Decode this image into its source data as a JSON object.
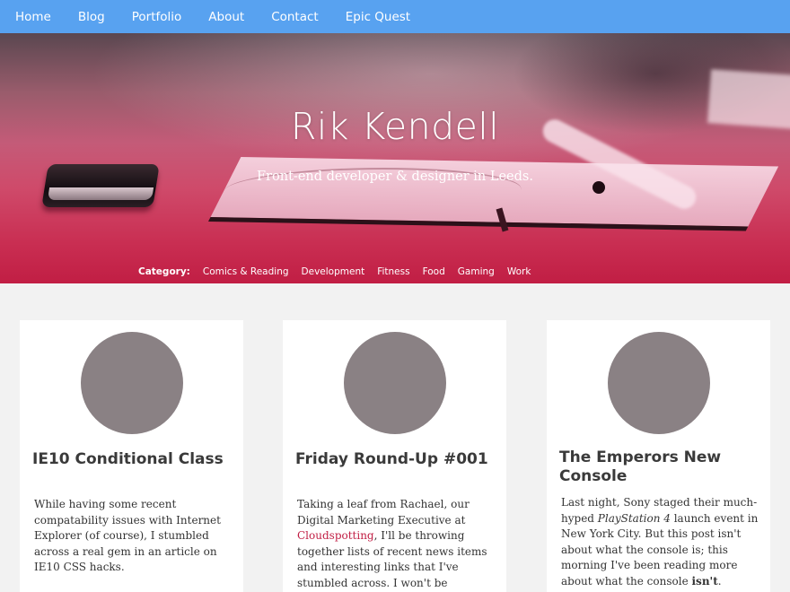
{
  "nav": {
    "items": [
      "Home",
      "Blog",
      "Portfolio",
      "About",
      "Contact",
      "Epic Quest"
    ]
  },
  "hero": {
    "title": "Rik Kendell",
    "subtitle": "Front-end developer & designer in Leeds."
  },
  "categories": {
    "label": "Category:",
    "items": [
      "Comics & Reading",
      "Development",
      "Fitness",
      "Food",
      "Gaming",
      "Work"
    ]
  },
  "posts": [
    {
      "title": "IE10 Conditional Class",
      "excerpt": {
        "text": "While having some recent compatability issues with Internet Explorer (of course), I stumbled across a real gem in an article on IE10 CSS hacks."
      }
    },
    {
      "title": "Friday Round-Up #001",
      "excerpt": {
        "before": "Taking a leaf from Rachael, our Digital Marketing Executive at ",
        "link": "Cloudspotting",
        "after": ", I'll be throwing together lists of recent news items and interesting links that I've stumbled across. I won't be religiously posting a round-up every"
      }
    },
    {
      "title": "The Emperors New Console",
      "excerpt": {
        "before": "Last night, Sony staged their much-hyped ",
        "emphasis": "PlayStation 4",
        "middle": " launch event in New York City. But this post isn't about what the console is; this morning I've been reading more about what the console ",
        "strong": "isn't",
        "after": "."
      }
    }
  ],
  "colors": {
    "nav_bg": "#58a2f0",
    "accent": "#c11e44",
    "avatar": "#8a8184",
    "page_bg": "#f2f2f2"
  }
}
